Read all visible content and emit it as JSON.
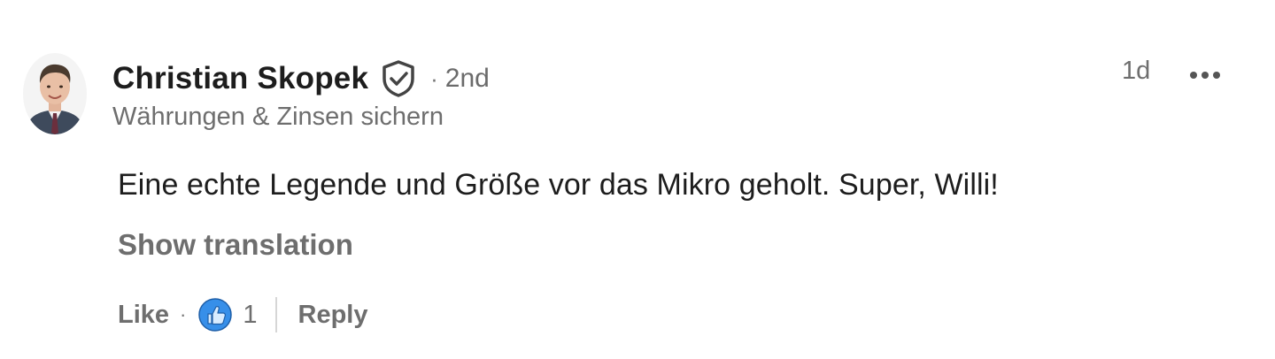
{
  "comment": {
    "author": {
      "name": "Christian Skopek",
      "degree_separator": "·",
      "degree": "2nd",
      "headline": "Währungen & Zinsen sichern",
      "avatar_icon": "profile-photo",
      "verified_icon": "verified-shield-icon"
    },
    "timestamp": "1d",
    "more_icon": "more-options-icon",
    "text": "Eine echte Legende und Größe vor das Mikro geholt. Super, Willi!",
    "show_translation_label": "Show translation",
    "actions": {
      "like_label": "Like",
      "separator": "·",
      "reaction_icon": "like-reaction-icon",
      "reaction_count": "1",
      "reply_label": "Reply"
    }
  },
  "colors": {
    "primary_text": "#1d1d1d",
    "secondary_text": "#6e6e6e",
    "like_blue": "#378fe9",
    "divider": "#d6d6d6"
  }
}
